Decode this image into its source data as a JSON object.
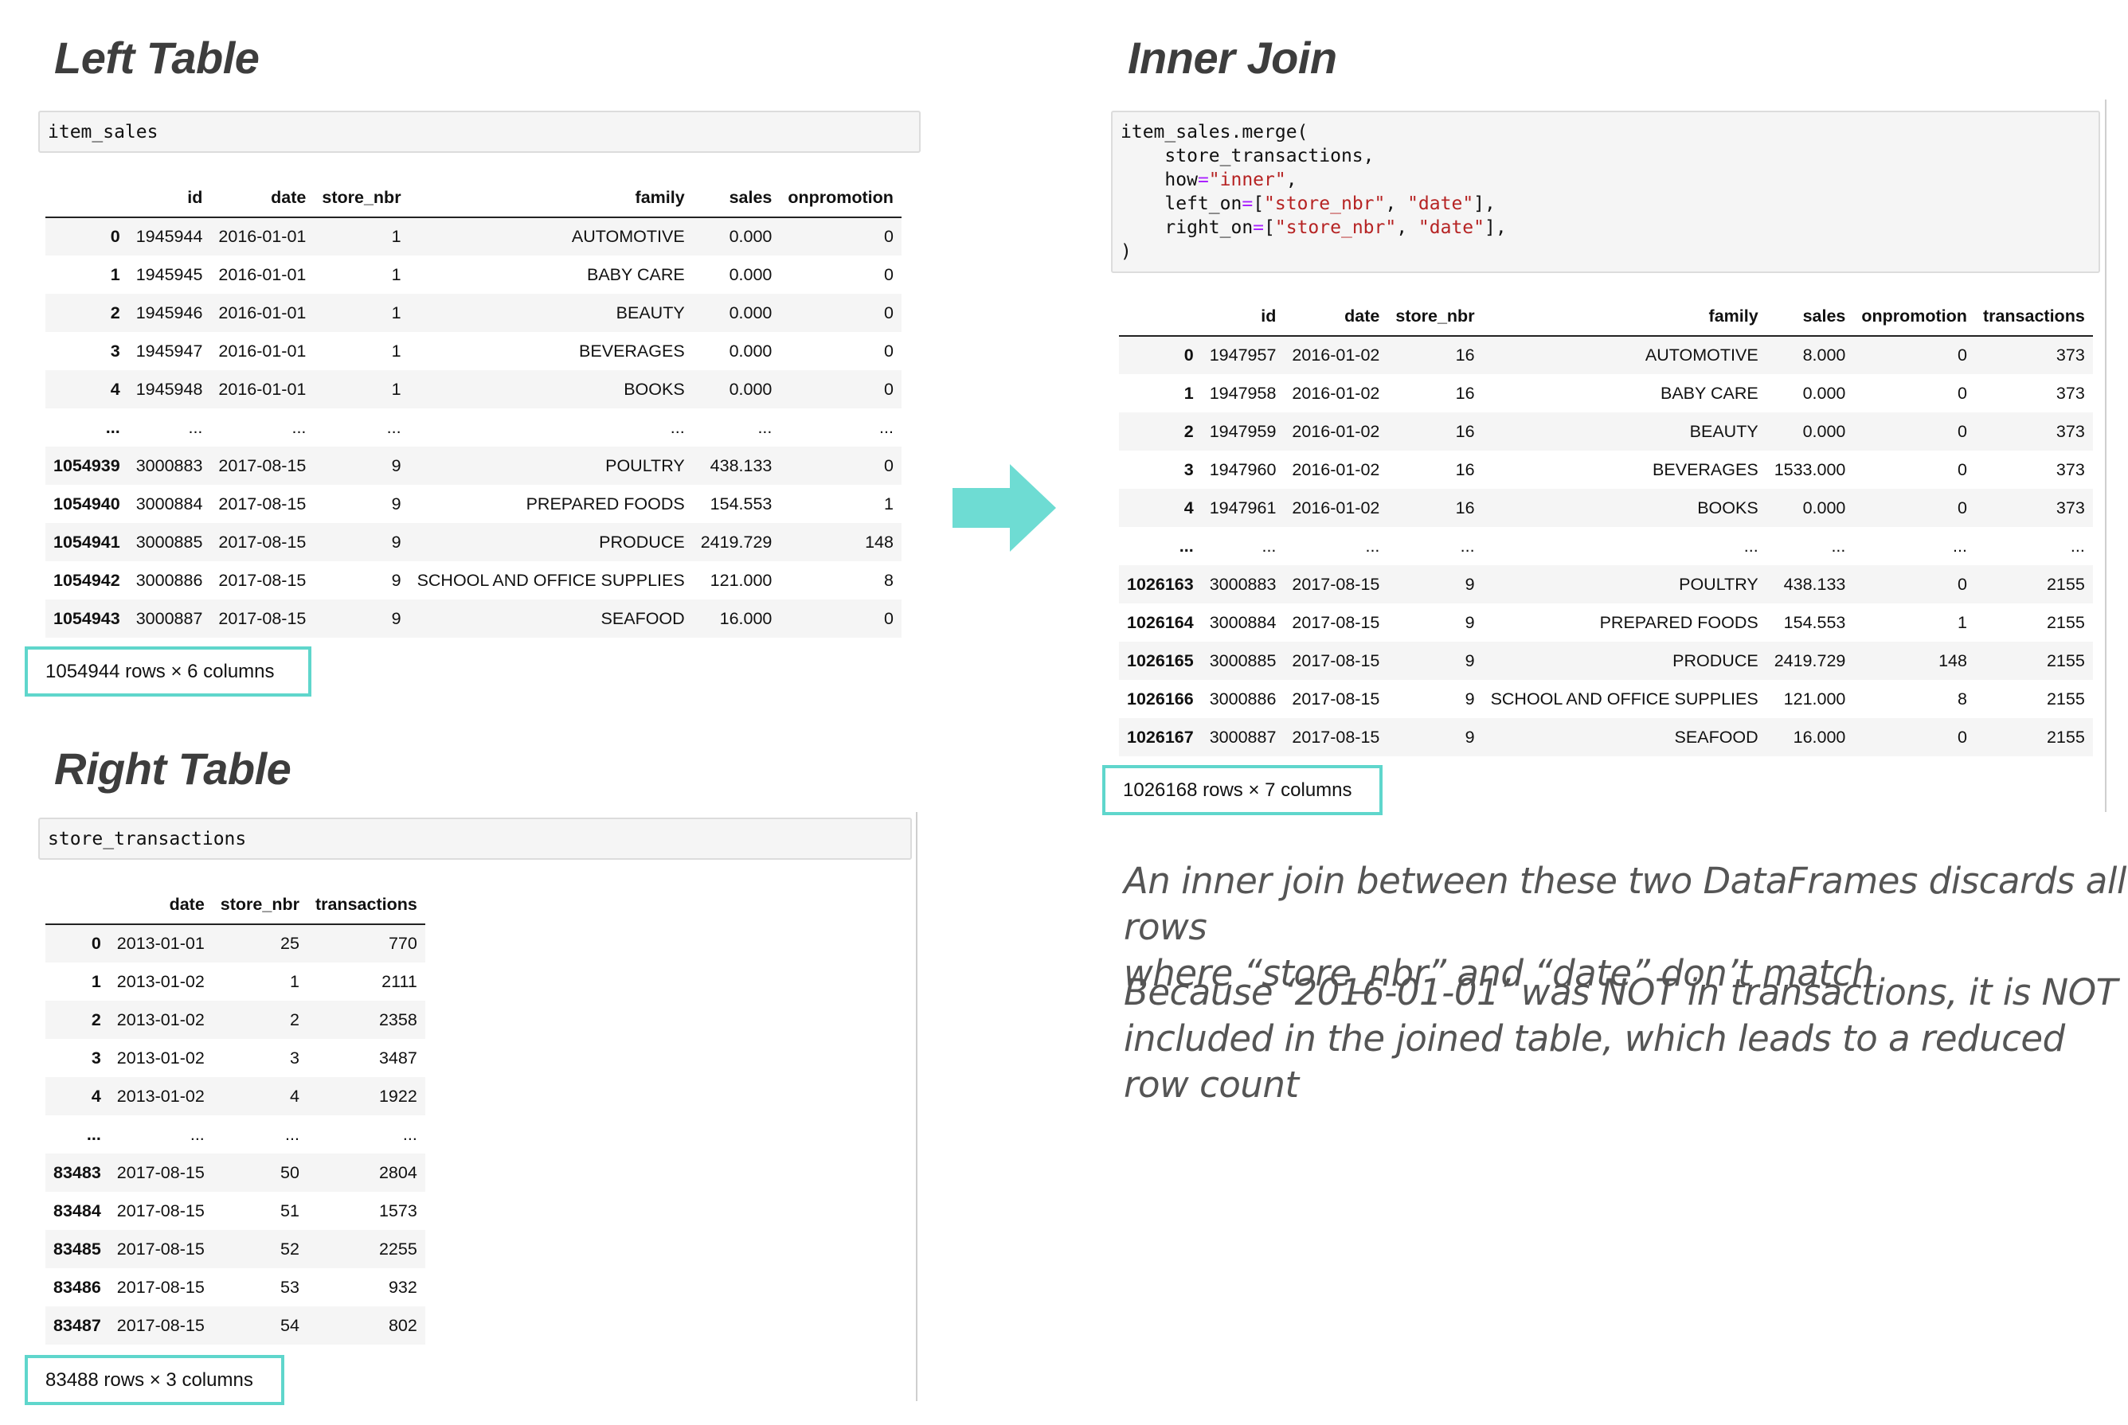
{
  "left": {
    "heading": "Left Table",
    "code": "item_sales",
    "columns": [
      "",
      "id",
      "date",
      "store_nbr",
      "family",
      "sales",
      "onpromotion"
    ],
    "rows": [
      [
        "0",
        "1945944",
        "2016-01-01",
        "1",
        "AUTOMOTIVE",
        "0.000",
        "0"
      ],
      [
        "1",
        "1945945",
        "2016-01-01",
        "1",
        "BABY CARE",
        "0.000",
        "0"
      ],
      [
        "2",
        "1945946",
        "2016-01-01",
        "1",
        "BEAUTY",
        "0.000",
        "0"
      ],
      [
        "3",
        "1945947",
        "2016-01-01",
        "1",
        "BEVERAGES",
        "0.000",
        "0"
      ],
      [
        "4",
        "1945948",
        "2016-01-01",
        "1",
        "BOOKS",
        "0.000",
        "0"
      ],
      [
        "...",
        "...",
        "...",
        "...",
        "...",
        "...",
        "..."
      ],
      [
        "1054939",
        "3000883",
        "2017-08-15",
        "9",
        "POULTRY",
        "438.133",
        "0"
      ],
      [
        "1054940",
        "3000884",
        "2017-08-15",
        "9",
        "PREPARED FOODS",
        "154.553",
        "1"
      ],
      [
        "1054941",
        "3000885",
        "2017-08-15",
        "9",
        "PRODUCE",
        "2419.729",
        "148"
      ],
      [
        "1054942",
        "3000886",
        "2017-08-15",
        "9",
        "SCHOOL AND OFFICE SUPPLIES",
        "121.000",
        "8"
      ],
      [
        "1054943",
        "3000887",
        "2017-08-15",
        "9",
        "SEAFOOD",
        "16.000",
        "0"
      ]
    ],
    "shape": "1054944 rows × 6 columns"
  },
  "right": {
    "heading": "Right Table",
    "code": "store_transactions",
    "columns": [
      "",
      "date",
      "store_nbr",
      "transactions"
    ],
    "rows": [
      [
        "0",
        "2013-01-01",
        "25",
        "770"
      ],
      [
        "1",
        "2013-01-02",
        "1",
        "2111"
      ],
      [
        "2",
        "2013-01-02",
        "2",
        "2358"
      ],
      [
        "3",
        "2013-01-02",
        "3",
        "3487"
      ],
      [
        "4",
        "2013-01-02",
        "4",
        "1922"
      ],
      [
        "...",
        "...",
        "...",
        "..."
      ],
      [
        "83483",
        "2017-08-15",
        "50",
        "2804"
      ],
      [
        "83484",
        "2017-08-15",
        "51",
        "1573"
      ],
      [
        "83485",
        "2017-08-15",
        "52",
        "2255"
      ],
      [
        "83486",
        "2017-08-15",
        "53",
        "932"
      ],
      [
        "83487",
        "2017-08-15",
        "54",
        "802"
      ]
    ],
    "shape": "83488 rows × 3 columns"
  },
  "inner": {
    "heading": "Inner Join",
    "code": {
      "line1": "item_sales.merge(",
      "line2": "    store_transactions,",
      "line3_a": "    how",
      "line3_op": "=",
      "line3_str": "\"inner\"",
      "line3_b": ",",
      "line4_a": "    left_on",
      "line4_op": "=",
      "line4_b": "[",
      "line4_s1": "\"store_nbr\"",
      "line4_c": ", ",
      "line4_s2": "\"date\"",
      "line4_d": "],",
      "line5_a": "    right_on",
      "line5_op": "=",
      "line5_b": "[",
      "line5_s1": "\"store_nbr\"",
      "line5_c": ", ",
      "line5_s2": "\"date\"",
      "line5_d": "],",
      "line6": ")"
    },
    "columns": [
      "",
      "id",
      "date",
      "store_nbr",
      "family",
      "sales",
      "onpromotion",
      "transactions"
    ],
    "rows": [
      [
        "0",
        "1947957",
        "2016-01-02",
        "16",
        "AUTOMOTIVE",
        "8.000",
        "0",
        "373"
      ],
      [
        "1",
        "1947958",
        "2016-01-02",
        "16",
        "BABY CARE",
        "0.000",
        "0",
        "373"
      ],
      [
        "2",
        "1947959",
        "2016-01-02",
        "16",
        "BEAUTY",
        "0.000",
        "0",
        "373"
      ],
      [
        "3",
        "1947960",
        "2016-01-02",
        "16",
        "BEVERAGES",
        "1533.000",
        "0",
        "373"
      ],
      [
        "4",
        "1947961",
        "2016-01-02",
        "16",
        "BOOKS",
        "0.000",
        "0",
        "373"
      ],
      [
        "...",
        "...",
        "...",
        "...",
        "...",
        "...",
        "...",
        "..."
      ],
      [
        "1026163",
        "3000883",
        "2017-08-15",
        "9",
        "POULTRY",
        "438.133",
        "0",
        "2155"
      ],
      [
        "1026164",
        "3000884",
        "2017-08-15",
        "9",
        "PREPARED FOODS",
        "154.553",
        "1",
        "2155"
      ],
      [
        "1026165",
        "3000885",
        "2017-08-15",
        "9",
        "PRODUCE",
        "2419.729",
        "148",
        "2155"
      ],
      [
        "1026166",
        "3000886",
        "2017-08-15",
        "9",
        "SCHOOL AND OFFICE SUPPLIES",
        "121.000",
        "8",
        "2155"
      ],
      [
        "1026167",
        "3000887",
        "2017-08-15",
        "9",
        "SEAFOOD",
        "16.000",
        "0",
        "2155"
      ]
    ],
    "shape": "1026168 rows × 7 columns"
  },
  "explanation": {
    "p1_line1": "An inner join between these two DataFrames discards all rows",
    "p1_line2": "where “store_nbr” and “date” don’t match",
    "p2_line1": "Because ‘2016-01-01’ was NOT in transactions, it is NOT",
    "p2_line2": "included in the joined table, which leads to a reduced row count"
  },
  "arrow_icon": "right-arrow-icon",
  "colors": {
    "accent": "#5fd6cc",
    "arrow": "#6edcd3",
    "code_string": "#b62323",
    "code_operator": "#aa22ff"
  }
}
